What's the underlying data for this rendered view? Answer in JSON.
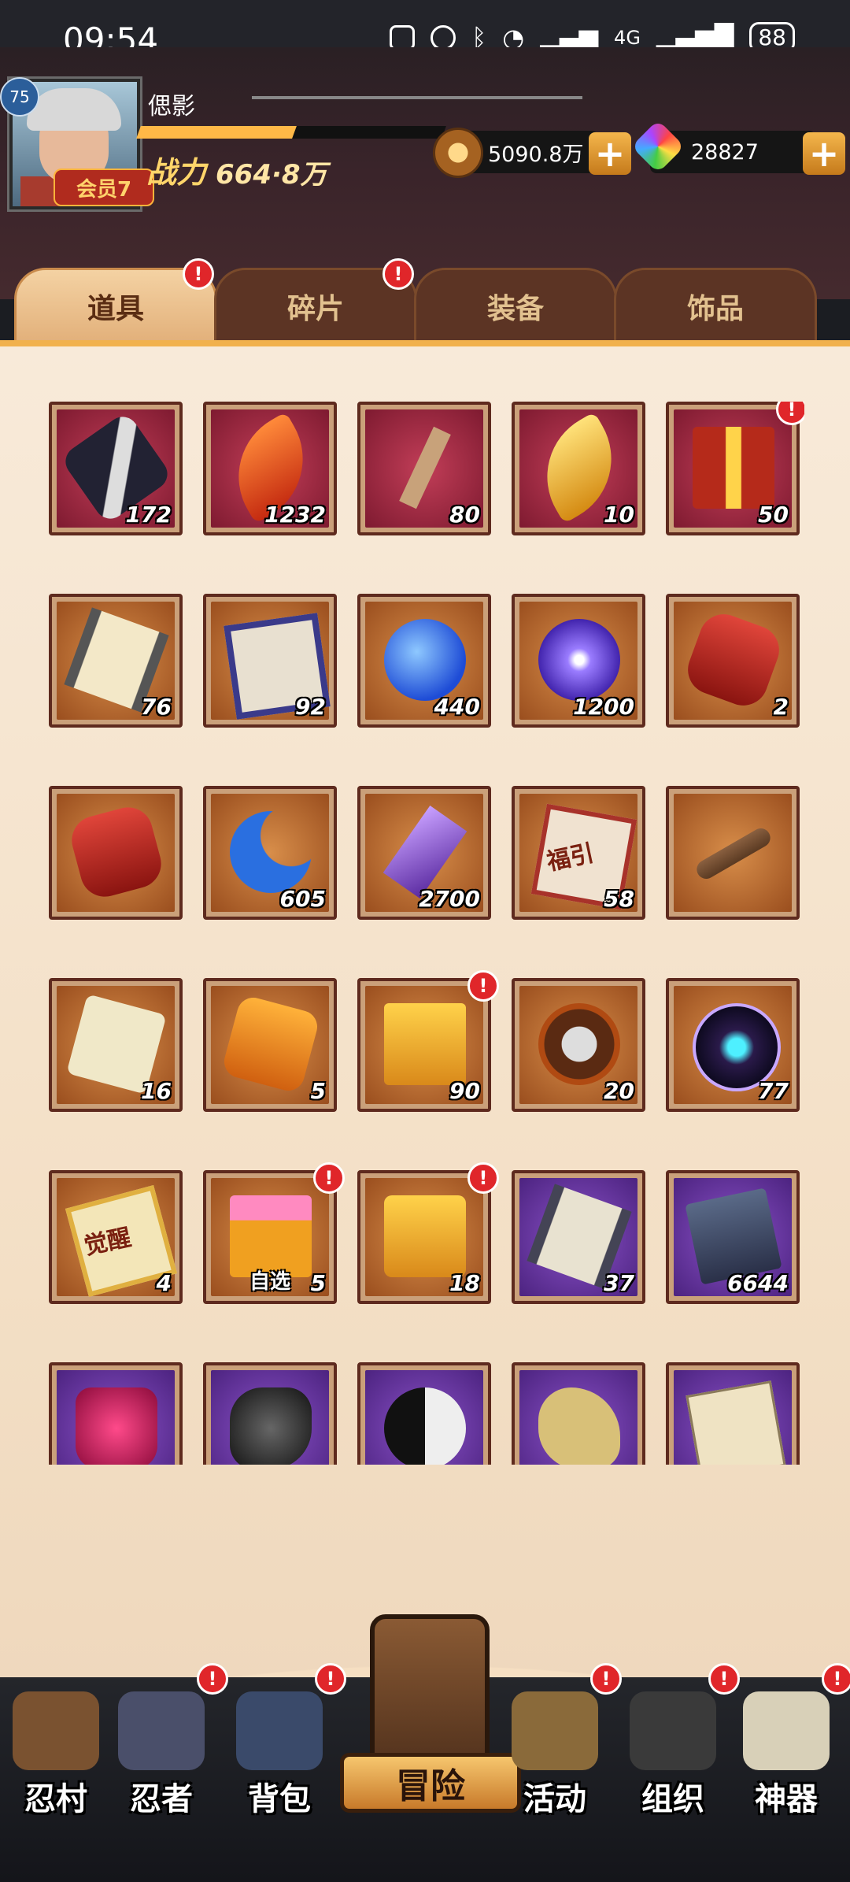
{
  "status_bar": {
    "time": "09:54",
    "battery": "88",
    "network": "4G"
  },
  "player": {
    "name": "偲影",
    "level": "75",
    "vip_label": "会员7",
    "power_label": "战力",
    "power_value": "664·8万",
    "exp_fraction": 0.6
  },
  "currency": {
    "coins": "5090.8万",
    "gems": "28827",
    "add_label": "+"
  },
  "tabs": [
    {
      "label": "道具",
      "active": true,
      "badge": "!"
    },
    {
      "label": "碎片",
      "active": false,
      "badge": "!"
    },
    {
      "label": "装备",
      "active": false,
      "badge": ""
    },
    {
      "label": "饰品",
      "active": false,
      "badge": ""
    }
  ],
  "items": [
    {
      "icon": "scroll-bundle-icon",
      "count": "172",
      "bg": "red"
    },
    {
      "icon": "feather-icon",
      "count": "1232",
      "bg": "red"
    },
    {
      "icon": "stick-icon",
      "count": "80",
      "bg": "red"
    },
    {
      "icon": "gold-feather-icon",
      "count": "10",
      "bg": "red"
    },
    {
      "icon": "gift-box-icon",
      "count": "50",
      "bg": "red",
      "badge": "!"
    },
    {
      "icon": "scroll-icon",
      "count": "76",
      "bg": "orange"
    },
    {
      "icon": "ninja-banner-icon",
      "count": "92",
      "bg": "orange"
    },
    {
      "icon": "blue-orb-icon",
      "count": "440",
      "bg": "orange"
    },
    {
      "icon": "purple-orb-icon",
      "count": "1200",
      "bg": "orange"
    },
    {
      "icon": "red-stone-icon",
      "count": "2",
      "bg": "orange"
    },
    {
      "icon": "red-gem-icon",
      "count": "",
      "bg": "orange"
    },
    {
      "icon": "moon-icon",
      "count": "605",
      "bg": "orange"
    },
    {
      "icon": "crystal-icon",
      "count": "2700",
      "bg": "orange"
    },
    {
      "icon": "fortune-ticket-icon",
      "count": "58",
      "bg": "orange",
      "text": "福引"
    },
    {
      "icon": "key-icon",
      "count": "",
      "bg": "orange"
    },
    {
      "icon": "paper-icon",
      "count": "16",
      "bg": "orange"
    },
    {
      "icon": "amber-stone-icon",
      "count": "5",
      "bg": "orange"
    },
    {
      "icon": "gold-box-icon",
      "count": "90",
      "bg": "orange",
      "badge": "!"
    },
    {
      "icon": "shuriken-icon",
      "count": "20",
      "bg": "orange"
    },
    {
      "icon": "blue-flame-orb-icon",
      "count": "77",
      "bg": "orange"
    },
    {
      "icon": "awaken-ticket-icon",
      "count": "4",
      "bg": "orange",
      "text": "觉醒"
    },
    {
      "icon": "select-box-icon",
      "count": "5",
      "bg": "orange",
      "badge": "!",
      "sub": "自选"
    },
    {
      "icon": "gold-chest-icon",
      "count": "18",
      "bg": "orange",
      "badge": "!"
    },
    {
      "icon": "purple-scroll-icon",
      "count": "37",
      "bg": "purple"
    },
    {
      "icon": "book-icon",
      "count": "6644",
      "bg": "purple"
    },
    {
      "icon": "potion-jar-icon",
      "count": "",
      "bg": "purple"
    },
    {
      "icon": "black-ore-icon",
      "count": "",
      "bg": "purple"
    },
    {
      "icon": "yin-yang-icon",
      "count": "",
      "bg": "purple"
    },
    {
      "icon": "puzzle-piece-icon",
      "count": "",
      "bg": "purple"
    },
    {
      "icon": "paper-stack-icon",
      "count": "",
      "bg": "purple"
    }
  ],
  "nav": [
    {
      "label": "忍村",
      "icon": "village-gate-icon",
      "badge": ""
    },
    {
      "label": "忍者",
      "icon": "ninja-head-icon",
      "badge": "!"
    },
    {
      "label": "背包",
      "icon": "backpack-icon",
      "badge": "!"
    },
    {
      "label": "冒险",
      "icon": "adventure-scroll-icon",
      "badge": ""
    },
    {
      "label": "活动",
      "icon": "drum-icon",
      "badge": "!"
    },
    {
      "label": "组织",
      "icon": "group-icon",
      "badge": "!"
    },
    {
      "label": "神器",
      "icon": "artifact-scroll-icon",
      "badge": "!"
    }
  ],
  "colors": {
    "accent": "#f5b64b",
    "badge": "#e0262a",
    "panel": "#f8ead9"
  }
}
